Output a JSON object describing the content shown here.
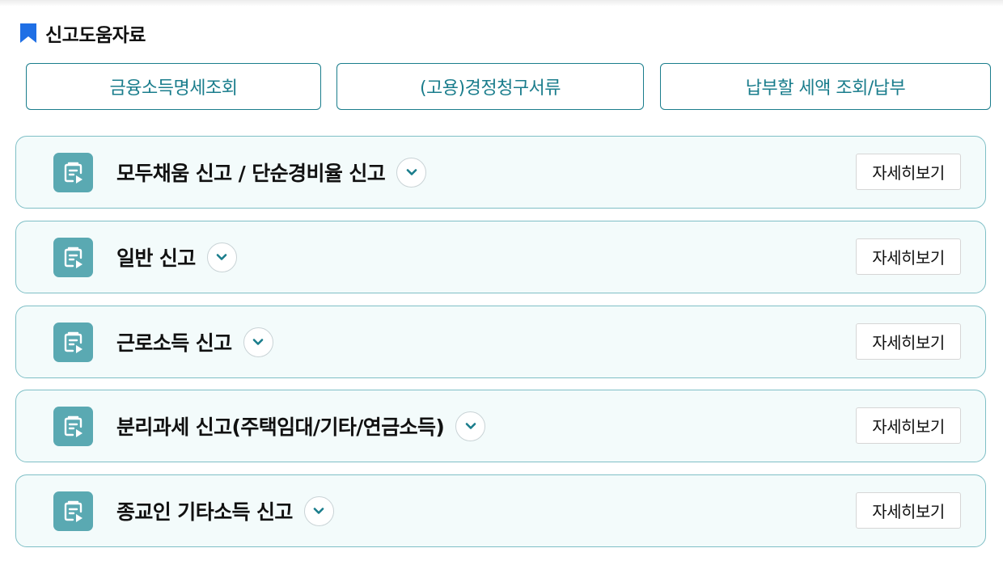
{
  "section": {
    "title": "신고도움자료",
    "icon": "bookmark-icon",
    "accent": "#1f6fe5"
  },
  "quick_links": [
    {
      "label": "금융소득명세조회"
    },
    {
      "label": "(고용)경정청구서류"
    },
    {
      "label": "납부할 세액 조회/납부"
    }
  ],
  "cards": [
    {
      "title": "모두채움 신고 / 단순경비율 신고",
      "detail_label": "자세히보기",
      "icon": "document-play-icon",
      "expand_icon": "chevron-down-icon"
    },
    {
      "title": "일반 신고",
      "detail_label": "자세히보기",
      "icon": "document-play-icon",
      "expand_icon": "chevron-down-icon"
    },
    {
      "title": "근로소득 신고",
      "detail_label": "자세히보기",
      "icon": "document-play-icon",
      "expand_icon": "chevron-down-icon"
    },
    {
      "title": "분리과세 신고(주택임대/기타/연금소득)",
      "detail_label": "자세히보기",
      "icon": "document-play-icon",
      "expand_icon": "chevron-down-icon"
    },
    {
      "title": "종교인 기타소득 신고",
      "detail_label": "자세히보기",
      "icon": "document-play-icon",
      "expand_icon": "chevron-down-icon"
    }
  ],
  "colors": {
    "teal": "#1a7d8c",
    "card_bg": "#f3fbfb",
    "card_border": "#7fbfc6",
    "icon_bg": "#5aa9b2"
  }
}
